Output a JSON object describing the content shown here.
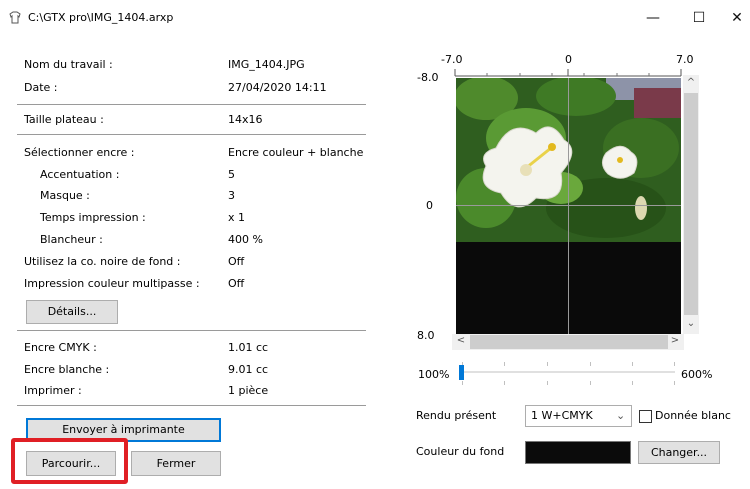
{
  "window": {
    "title": "C:\\GTX pro\\IMG_1404.arxp",
    "minimize": "—",
    "maximize": "☐",
    "close": "✕"
  },
  "info": {
    "job_name_label": "Nom du travail :",
    "job_name_value": "IMG_1404.JPG",
    "date_label": "Date :",
    "date_value": "27/04/2020 14:11",
    "platen_label": "Taille plateau :",
    "platen_value": "14x16",
    "ink_label": "Sélectionner encre :",
    "ink_value": "Encre couleur + blanche",
    "accent_label": "Accentuation :",
    "accent_value": "5",
    "mask_label": "Masque :",
    "mask_value": "3",
    "time_label": "Temps impression :",
    "time_value": "x 1",
    "white_label": "Blancheur :",
    "white_value": "400 %",
    "black_label": "Utilisez la co. noire de fond :",
    "black_value": "Off",
    "multipass_label": "Impression couleur multipasse :",
    "multipass_value": "Off",
    "details_button": "Détails...",
    "cmyk_label": "Encre CMYK :",
    "cmyk_value": "1.01 cc",
    "whiteink_label": "Encre blanche :",
    "whiteink_value": "9.01 cc",
    "print_label": "Imprimer :",
    "print_value": "1 pièce"
  },
  "buttons": {
    "send": "Envoyer à imprimante",
    "browse": "Parcourir...",
    "close": "Fermer"
  },
  "preview": {
    "x_min": "-7.0",
    "x_zero": "0",
    "x_max": "7.0",
    "y_min": "-8.0",
    "y_zero": "0",
    "y_max": "8.0",
    "zoom_min": "100%",
    "zoom_max": "600%",
    "zoom_level": 0
  },
  "render": {
    "label": "Rendu présent",
    "selected": "1  W+CMYK",
    "white_data_label": "Donnée blanc",
    "white_data_checked": false,
    "bg_color_label": "Couleur du fond",
    "bg_color": "#0b0b0b",
    "change_button": "Changer..."
  }
}
